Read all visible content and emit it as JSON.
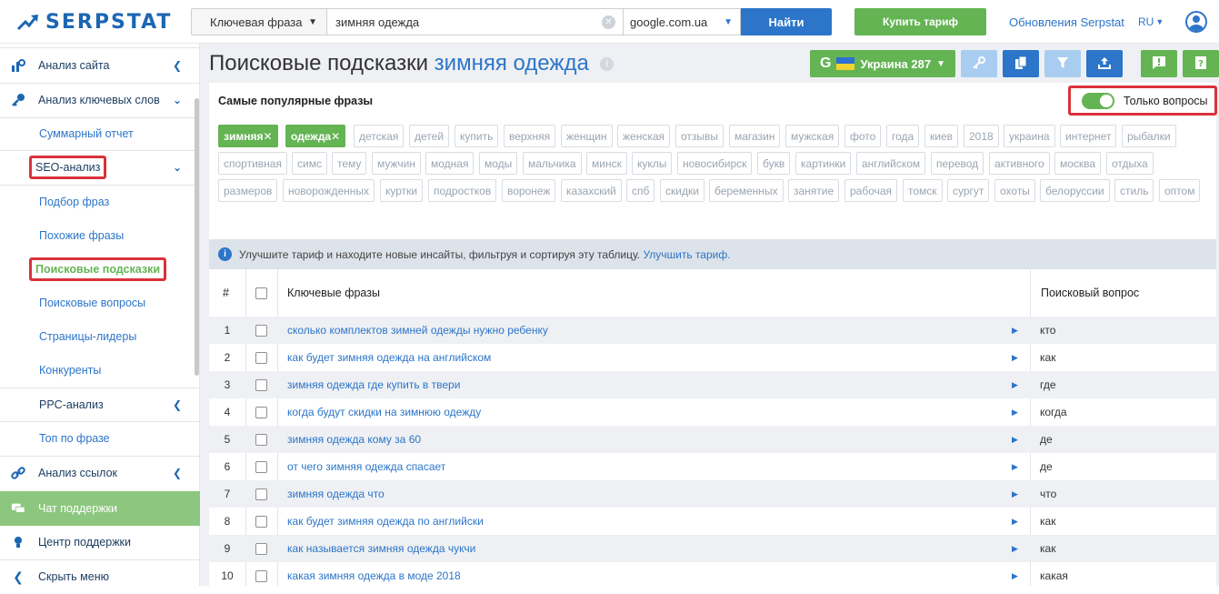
{
  "header": {
    "logo_text": "SERPSTAT",
    "search_type": "Ключевая фраза",
    "search_value": "зимняя одежда",
    "engine": "google.com.ua",
    "search_button": "Найти",
    "buy_button": "Купить тариф",
    "updates_link": "Обновления Serpstat",
    "lang": "RU"
  },
  "sidebar": {
    "site_analysis": "Анализ сайта",
    "keyword_analysis": "Анализ ключевых слов",
    "summary": "Суммарный отчет",
    "seo_analysis": "SEO-анализ",
    "phrase_selection": "Подбор фраз",
    "similar_phrases": "Похожие фразы",
    "search_suggestions": "Поисковые подсказки",
    "search_questions": "Поисковые вопросы",
    "leader_pages": "Страницы-лидеры",
    "competitors": "Конкуренты",
    "ppc_analysis": "PPC-анализ",
    "top_by_phrase": "Топ по фразе",
    "link_analysis": "Анализ ссылок",
    "support_chat": "Чат поддержки",
    "support_center": "Центр поддержки",
    "hide_menu": "Скрыть меню"
  },
  "main": {
    "title_prefix": "Поисковые подсказки",
    "title_keyword": "зимняя одежда",
    "db_button": "Украина 287",
    "popular_title": "Самые популярные фразы",
    "only_questions": "Только вопросы",
    "upgrade_text": "Улучшите тариф и находите новые инсайты, фильтруя и сортируя эту таблицу.",
    "upgrade_link": "Улучшить тариф.",
    "chips": [
      "зимняя",
      "одежда",
      "детская",
      "детей",
      "купить",
      "верхняя",
      "женщин",
      "женская",
      "отзывы",
      "магазин",
      "мужская",
      "фото",
      "года",
      "киев",
      "2018",
      "украина",
      "интернет",
      "рыбалки",
      "спортивная",
      "симс",
      "тему",
      "мужчин",
      "модная",
      "моды",
      "мальчика",
      "минск",
      "куклы",
      "новосибирск",
      "букв",
      "картинки",
      "английском",
      "перевод",
      "активного",
      "москва",
      "отдыха",
      "размеров",
      "новорожденных",
      "куртки",
      "подростков",
      "воронеж",
      "казахский",
      "спб",
      "скидки",
      "беременных",
      "занятие",
      "рабочая",
      "томск",
      "сургут",
      "охоты",
      "белоруссии",
      "стиль",
      "оптом"
    ],
    "table": {
      "col_num": "#",
      "col_keyword": "Ключевые фразы",
      "col_question": "Поисковый вопрос",
      "rows": [
        {
          "n": "1",
          "kw": "сколько комплектов зимней одежды нужно ребенку",
          "q": "кто"
        },
        {
          "n": "2",
          "kw": "как будет зимняя одежда на английском",
          "q": "как"
        },
        {
          "n": "3",
          "kw": "зимняя одежда где купить в твери",
          "q": "где"
        },
        {
          "n": "4",
          "kw": "когда будут скидки на зимнюю одежду",
          "q": "когда"
        },
        {
          "n": "5",
          "kw": "зимняя одежда кому за 60",
          "q": "де"
        },
        {
          "n": "6",
          "kw": "от чего зимняя одежда спасает",
          "q": "де"
        },
        {
          "n": "7",
          "kw": "зимняя одежда что",
          "q": "что"
        },
        {
          "n": "8",
          "kw": "как будет зимняя одежда по английски",
          "q": "как"
        },
        {
          "n": "9",
          "kw": "как называется зимняя одежда чукчи",
          "q": "как"
        },
        {
          "n": "10",
          "kw": "какая зимняя одежда в моде 2018",
          "q": "какая"
        }
      ]
    }
  },
  "colors": {
    "accent_blue": "#2c75c9",
    "accent_green": "#64b454",
    "highlight_red": "#d9323a"
  }
}
